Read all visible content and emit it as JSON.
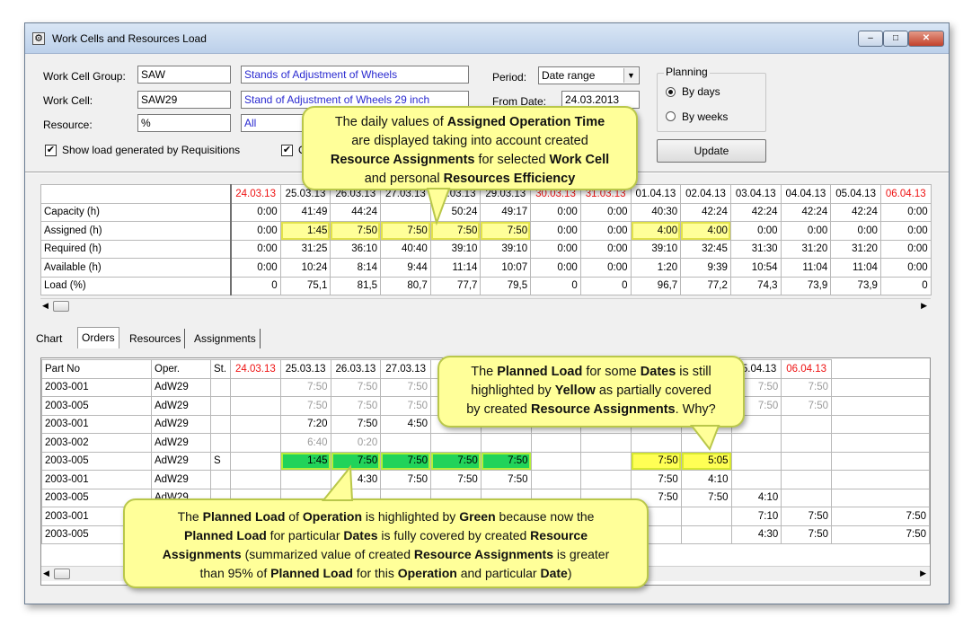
{
  "window": {
    "title": "Work Cells and Resources Load",
    "min": "–",
    "max": "□",
    "close": "✕"
  },
  "filters": {
    "work_cell_group_label": "Work Cell Group:",
    "work_cell_group_code": "SAW",
    "work_cell_group_name": "Stands of Adjustment of Wheels",
    "work_cell_label": "Work Cell:",
    "work_cell_code": "SAW29",
    "work_cell_name": "Stand of Adjustment of Wheels 29 inch",
    "resource_label": "Resource:",
    "resource_code": "%",
    "resource_name": "All",
    "show_requisitions_label": "Show load generated by Requisitions",
    "second_checkbox_label": "C",
    "period_label": "Period:",
    "period_value": "Date range",
    "from_date_label": "From Date:",
    "from_date_value": "24.03.2013"
  },
  "planning": {
    "title": "Planning",
    "by_days": "By days",
    "by_weeks": "By weeks"
  },
  "update_button": "Update",
  "summary": {
    "dates": [
      "24.03.13",
      "25.03.13",
      "26.03.13",
      "27.03.13",
      "28.03.13",
      "29.03.13",
      "30.03.13",
      "31.03.13",
      "01.04.13",
      "02.04.13",
      "03.04.13",
      "04.04.13",
      "05.04.13",
      "06.04.13"
    ],
    "rows": [
      {
        "label": "Capacity (h)",
        "values": [
          "0:00",
          "41:49",
          "44:24",
          "",
          "50:24",
          "49:17",
          "0:00",
          "0:00",
          "40:30",
          "42:24",
          "42:24",
          "42:24",
          "42:24",
          "0:00"
        ]
      },
      {
        "label": "Assigned (h)",
        "values": [
          "0:00",
          "1:45",
          "7:50",
          "7:50",
          "7:50",
          "7:50",
          "0:00",
          "0:00",
          "4:00",
          "4:00",
          "0:00",
          "0:00",
          "0:00",
          "0:00"
        ]
      },
      {
        "label": "Required (h)",
        "values": [
          "0:00",
          "31:25",
          "36:10",
          "40:40",
          "39:10",
          "39:10",
          "0:00",
          "0:00",
          "39:10",
          "32:45",
          "31:30",
          "31:20",
          "31:20",
          "0:00"
        ]
      },
      {
        "label": "Available (h)",
        "values": [
          "0:00",
          "10:24",
          "8:14",
          "9:44",
          "11:14",
          "10:07",
          "0:00",
          "0:00",
          "1:20",
          "9:39",
          "10:54",
          "11:04",
          "11:04",
          "0:00"
        ]
      },
      {
        "label": "Load (%)",
        "values": [
          "0",
          "75,1",
          "81,5",
          "80,7",
          "77,7",
          "79,5",
          "0",
          "0",
          "96,7",
          "77,2",
          "74,3",
          "73,9",
          "73,9",
          "0"
        ]
      }
    ]
  },
  "tabs": [
    "Chart",
    "Orders",
    "Resources",
    "Assignments"
  ],
  "orders": {
    "headers": [
      "Part No",
      "Oper.",
      "St.",
      "24.03.13",
      "25.03.13",
      "26.03.13",
      "27.03.13",
      "",
      "",
      "",
      "",
      "",
      "04.04.13",
      "05.04.13",
      "06.04.13"
    ],
    "header_partial": ".04.13",
    "rows": [
      {
        "part": "2003-001",
        "oper": "AdW29",
        "st": "",
        "v": [
          "",
          "7:50",
          "7:50",
          "7:50",
          "",
          "",
          "",
          "",
          "",
          "7:50",
          "7:50",
          "7:50",
          ""
        ]
      },
      {
        "part": "2003-005",
        "oper": "AdW29",
        "st": "",
        "v": [
          "",
          "7:50",
          "7:50",
          "7:50",
          "",
          "",
          "",
          "",
          "",
          "7:50",
          "7:50",
          "7:50",
          ""
        ]
      },
      {
        "part": "2003-001",
        "oper": "AdW29",
        "st": "",
        "v": [
          "",
          "7:20",
          "7:50",
          "4:50",
          "",
          "",
          "",
          "",
          "",
          "",
          "",
          "",
          ""
        ]
      },
      {
        "part": "2003-002",
        "oper": "AdW29",
        "st": "",
        "v": [
          "",
          "6:40",
          "0:20",
          "",
          "",
          "",
          "",
          "",
          "",
          "",
          "",
          "",
          ""
        ]
      },
      {
        "part": "2003-005",
        "oper": "AdW29",
        "st": "S",
        "v": [
          "",
          "1:45",
          "7:50",
          "7:50",
          "7:50",
          "7:50",
          "",
          "",
          "7:50",
          "5:05",
          "",
          "",
          ""
        ]
      },
      {
        "part": "2003-001",
        "oper": "AdW29",
        "st": "",
        "v": [
          "",
          "",
          "4:30",
          "7:50",
          "7:50",
          "7:50",
          "",
          "",
          "7:50",
          "4:10",
          "",
          "",
          ""
        ]
      },
      {
        "part": "2003-005",
        "oper": "AdW29",
        "st": "",
        "v": [
          "",
          "",
          "",
          "",
          "",
          "",
          "",
          "",
          "7:50",
          "7:50",
          "4:10",
          "",
          ""
        ]
      },
      {
        "part": "2003-001",
        "oper": "",
        "st": "",
        "v": [
          "",
          "",
          "",
          "",
          "",
          "",
          "",
          "",
          "",
          "",
          "7:10",
          "7:50",
          "7:50"
        ]
      },
      {
        "part": "2003-005",
        "oper": "",
        "st": "",
        "v": [
          "",
          "",
          "",
          "",
          "",
          "",
          "",
          "",
          "",
          "",
          "4:30",
          "7:50",
          "7:50"
        ]
      }
    ]
  },
  "callouts": {
    "top": {
      "l1a": "The daily values of ",
      "l1b": "Assigned Operation Time",
      "l2": "are displayed taking into account created",
      "l3a": "Resource Assignments",
      "l3b": " for selected ",
      "l3c": "Work Cell",
      "l4a": "and personal ",
      "l4b": "Resources Efficiency"
    },
    "right": {
      "l1a": "The ",
      "l1b": "Planned Load",
      "l1c": " for some ",
      "l1d": "Dates",
      "l1e": " is still",
      "l2a": "highlighted by ",
      "l2b": "Yellow",
      "l2c": " as partially covered",
      "l3a": "by created ",
      "l3b": "Resource Assignments",
      "l3c": ". Why?"
    },
    "bottom": {
      "l1a": "The ",
      "l1b": "Planned Load",
      "l1c": " of ",
      "l1d": "Operation",
      "l1e": " is highlighted by ",
      "l1f": "Green",
      "l1g": " because now the",
      "l2a": "Planned Load",
      "l2b": " for particular ",
      "l2c": "Dates",
      "l2d": " is fully covered by created ",
      "l2e": "Resource",
      "l3a": "Assignments",
      "l3b": " (summarized value of created ",
      "l3c": "Resource Assignments",
      "l3d": " is greater",
      "l4a": "than 95% of ",
      "l4b": "Planned Load",
      "l4c": " for this ",
      "l4d": "Operation",
      "l4e": " and particular ",
      "l4f": "Date",
      ")": ")"
    }
  },
  "colors": {
    "weekend": "#ee1111",
    "green": "#21d35a",
    "yellow": "#ffff99",
    "callout": "#ffff99"
  }
}
